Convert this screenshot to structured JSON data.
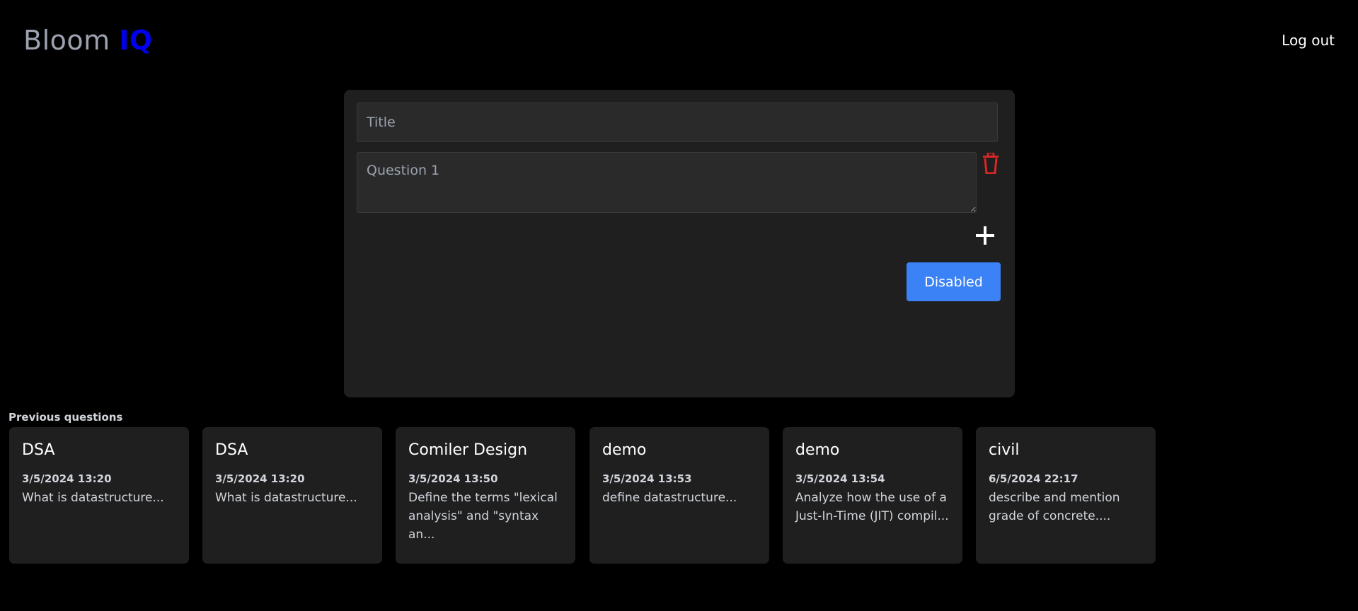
{
  "header": {
    "logo_main": "Bloom ",
    "logo_accent": "IQ",
    "logout_label": "Log out"
  },
  "form": {
    "title_placeholder": "Title",
    "title_value": "",
    "question_placeholder": "Question 1",
    "question_value": "",
    "delete_icon": "trash-icon",
    "add_icon": "plus-icon",
    "submit_label": "Disabled"
  },
  "previous": {
    "heading": "Previous questions",
    "cards": [
      {
        "title": "DSA",
        "date": "3/5/2024 13:20",
        "text": "What is datastructure..."
      },
      {
        "title": "DSA",
        "date": "3/5/2024 13:20",
        "text": "What is datastructure..."
      },
      {
        "title": "Comiler Design",
        "date": "3/5/2024 13:50",
        "text": "Define the terms \"lexical analysis\" and \"syntax an..."
      },
      {
        "title": "demo",
        "date": "3/5/2024 13:53",
        "text": "define datastructure..."
      },
      {
        "title": "demo",
        "date": "3/5/2024 13:54",
        "text": "Analyze how the use of a Just-In-Time (JIT) compil..."
      },
      {
        "title": "civil",
        "date": "6/5/2024 22:17",
        "text": "describe and mention grade of concrete...."
      }
    ]
  },
  "colors": {
    "background": "#000000",
    "card": "#1f1f1f",
    "accent": "#0000ee",
    "button": "#3b82f6",
    "delete": "#dc2626"
  }
}
